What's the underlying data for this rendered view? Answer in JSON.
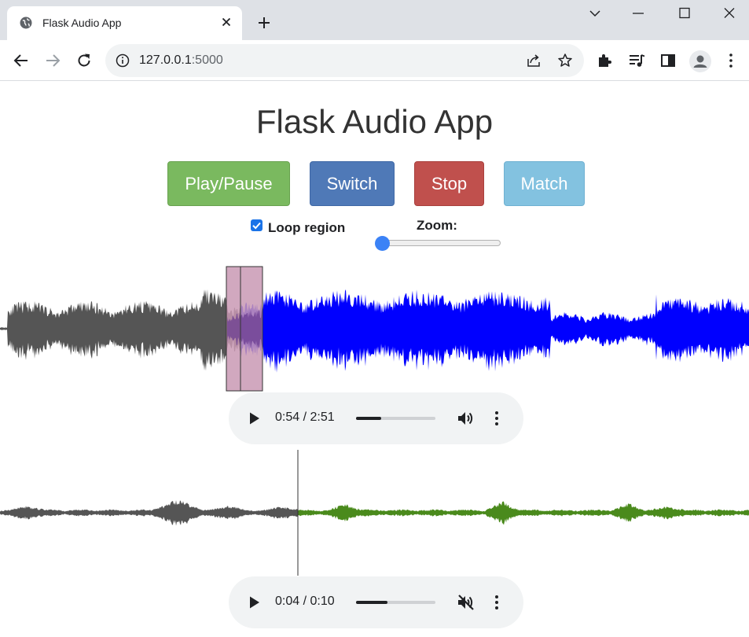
{
  "browser": {
    "tab_title": "Flask Audio App",
    "url_host": "127.0.0.1",
    "url_port": ":5000"
  },
  "page": {
    "title": "Flask Audio App",
    "buttons": {
      "play_pause": "Play/Pause",
      "switch": "Switch",
      "stop": "Stop",
      "match": "Match"
    },
    "loop_region_label": "Loop region",
    "loop_region_checked": true,
    "zoom_label": "Zoom:",
    "zoom_level": 0
  },
  "players": [
    {
      "time": "0:54 / 2:51",
      "progress": 0.32,
      "muted": false,
      "wave_played_color": "#555555",
      "wave_color": "#0000ff",
      "region_color": "#c999b4"
    },
    {
      "time": "0:04 / 0:10",
      "progress": 0.4,
      "muted": true,
      "wave_played_color": "#555555",
      "wave_color": "#4a8a1c"
    }
  ],
  "colors": {
    "play_pause": "#7ab95f",
    "switch": "#4f79b7",
    "stop": "#c0504d",
    "match": "#83c2e0"
  }
}
